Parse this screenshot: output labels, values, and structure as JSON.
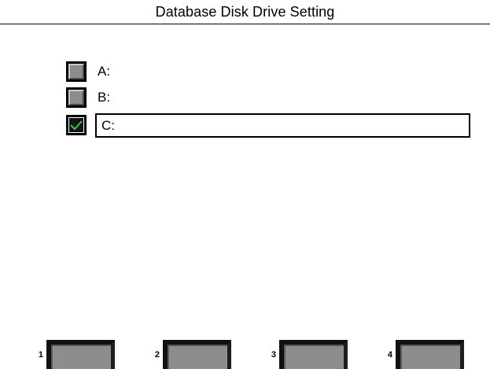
{
  "header": {
    "title": "Database Disk Drive Setting"
  },
  "drives": [
    {
      "label": "A:",
      "checked": false,
      "selected": false
    },
    {
      "label": "B:",
      "checked": false,
      "selected": false
    },
    {
      "label": "C:",
      "checked": true,
      "selected": true
    }
  ],
  "colors": {
    "check_mark": "#33cc33",
    "checkbox_off": "#8c8c8c",
    "key_face": "#8d8d8d"
  },
  "function_keys": [
    {
      "number": "1",
      "label": ""
    },
    {
      "number": "2",
      "label": ""
    },
    {
      "number": "3",
      "label": ""
    },
    {
      "number": "4",
      "label": ""
    }
  ]
}
